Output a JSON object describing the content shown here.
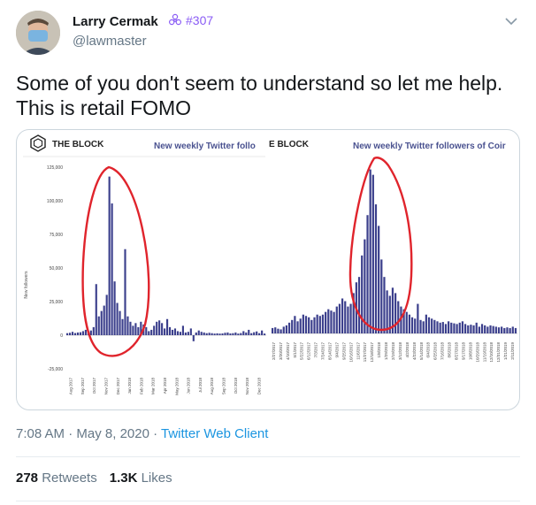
{
  "author": {
    "name": "Larry Cermak",
    "badge_text": "#307",
    "handle": "@lawmaster"
  },
  "tweet": {
    "line1": "Some of you don't seem to understand so let me help.",
    "line2": "This is retail FOMO"
  },
  "media": {
    "left_panel": {
      "brand": "THE BLOCK",
      "title": "New weekly Twitter follo",
      "ylabel": "New followers",
      "yticks": [
        "125,000",
        "100,000",
        "75,000",
        "50,000",
        "25,000",
        "0",
        "-25,000"
      ]
    },
    "right_panel": {
      "brand": "E BLOCK",
      "title": "New weekly Twitter followers of Coir"
    },
    "annotation_color": "#e0242c",
    "bar_color": "#3b3f8c"
  },
  "chart_data": [
    {
      "type": "bar",
      "title": "New weekly Twitter follo",
      "ylabel": "New followers",
      "ylim": [
        -25000,
        125000
      ],
      "categories": [
        "Aug 2017",
        "Sep 2017",
        "Oct 2017",
        "Nov 2017",
        "Dec 2017",
        "Jan 2018",
        "Feb 2018",
        "Mar 2018",
        "Apr 2018",
        "May 2018",
        "Jun 2018",
        "Jul 2018",
        "Aug 2018",
        "Sep 2018",
        "Oct 2018",
        "Nov 2018",
        "Dec 2018"
      ],
      "values": [
        1500,
        1800,
        2500,
        1600,
        2000,
        2200,
        3000,
        4000,
        2500,
        3500,
        6000,
        38000,
        14000,
        18000,
        22000,
        30000,
        118000,
        98000,
        40000,
        24000,
        18000,
        12000,
        64000,
        14000,
        10000,
        7000,
        9000,
        6000,
        10000,
        8000,
        6000,
        3000,
        4000,
        7000,
        10000,
        11000,
        9000,
        5000,
        12000,
        6000,
        4000,
        5000,
        3000,
        2500,
        7000,
        2000,
        2500,
        5000,
        -4500,
        2000,
        3500,
        2500,
        2000,
        1500,
        1800,
        1500,
        1200,
        1400,
        1200,
        1300,
        1800,
        2000,
        1300,
        1500,
        2000,
        1200,
        1600,
        3000,
        2000,
        4000,
        1500,
        2200,
        2800,
        1500,
        3500,
        1200
      ]
    },
    {
      "type": "bar",
      "title": "New weekly Twitter followers of Coir",
      "categories": [
        "2/27/2017",
        "3/20/2017",
        "4/10/2017",
        "5/1/2017",
        "5/22/2017",
        "6/12/2017",
        "7/3/2017",
        "7/24/2017",
        "8/14/2017",
        "9/4/2017",
        "9/25/2017",
        "10/16/2017",
        "11/6/2017",
        "11/27/2017",
        "12/18/2017",
        "1/8/2018",
        "1/29/2018",
        "2/19/2018",
        "3/12/2018",
        "4/2/2018",
        "4/23/2018",
        "5/14/2018",
        "6/4/2018",
        "6/25/2018",
        "7/16/2018",
        "8/6/2018",
        "8/27/2018",
        "9/17/2018",
        "10/8/2018",
        "10/29/2018",
        "11/19/2018",
        "12/10/2018",
        "12/31/2018",
        "1/21/2019",
        "2/11/2019"
      ],
      "values": [
        4000,
        4500,
        3500,
        3000,
        5000,
        6000,
        8000,
        10000,
        13000,
        9000,
        11000,
        14000,
        13000,
        12000,
        10000,
        12000,
        14000,
        13000,
        14000,
        16000,
        18000,
        17000,
        16000,
        20000,
        22000,
        26000,
        24000,
        20000,
        22000,
        30000,
        38000,
        42000,
        58000,
        70000,
        88000,
        122000,
        118000,
        96000,
        80000,
        55000,
        42000,
        32000,
        28000,
        34000,
        30000,
        24000,
        20000,
        18000,
        16000,
        14000,
        12000,
        11000,
        22000,
        10000,
        9000,
        14000,
        12000,
        11000,
        10000,
        9000,
        8000,
        8500,
        7000,
        9000,
        8000,
        7500,
        7000,
        8000,
        9000,
        7000,
        6000,
        6500,
        6000,
        8000,
        5000,
        7000,
        6000,
        5000,
        6000,
        5500,
        5000,
        4500,
        5000,
        4000,
        4500,
        4000,
        5000,
        4000
      ]
    }
  ],
  "meta": {
    "time": "7:08 AM",
    "dot1": " · ",
    "date": "May 8, 2020",
    "dot2": " · ",
    "client": "Twitter Web Client"
  },
  "stats": {
    "retweets_count": "278",
    "retweets_label": " Retweets",
    "likes_count": "1.3K",
    "likes_label": " Likes"
  }
}
